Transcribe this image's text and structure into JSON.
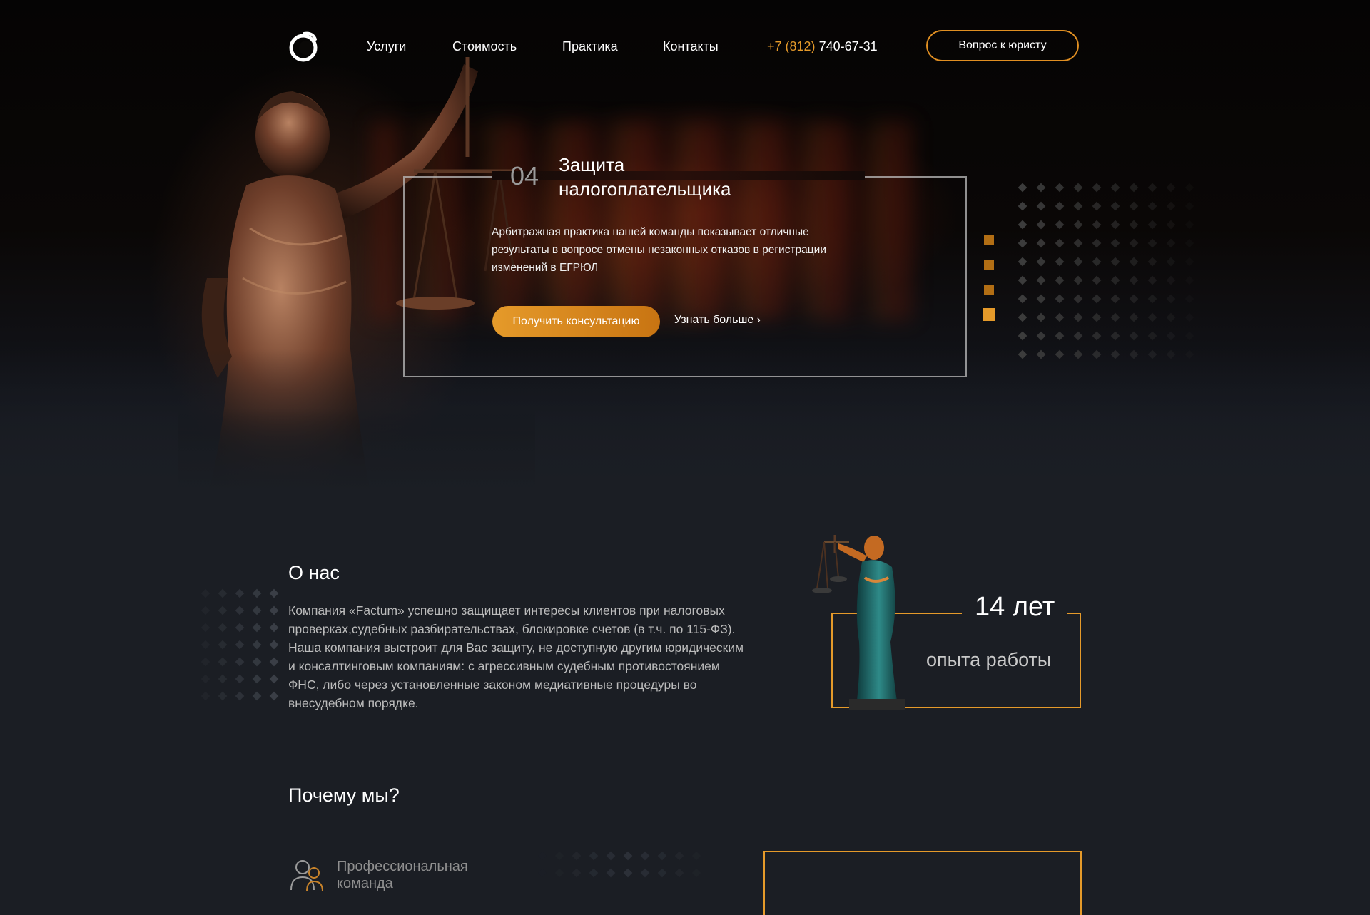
{
  "header": {
    "nav": [
      "Услуги",
      "Стоимость",
      "Практика",
      "Контакты"
    ],
    "phone_code": "+7 (812)",
    "phone_number": "740-67-31",
    "question_button": "Вопрос к юристу"
  },
  "hero": {
    "slide_number": "04",
    "title": "Защита налогоплательщика",
    "text": "Арбитражная практика нашей команды показывает отличные результаты в вопросе отмены незаконных отказов в регистрации изменений в ЕГРЮЛ",
    "consult_button": "Получить консультацию",
    "more_link": "Узнать больше ›",
    "slider": {
      "total": 4,
      "active": 4
    }
  },
  "about": {
    "title": "О нас",
    "text": "Компания «Factum» успешно защищает интересы клиентов при налоговых проверках,судебных разбирательствах, блокировке счетов (в т.ч. по 115-ФЗ). Наша компания выстроит для Вас защиту, не доступную другим юридическим и консалтинговым компаниям: с агрессивным судебным противостоянием ФНС, либо через установленные законом медиативные процедуры во внесудебном порядке.",
    "experience_years": "14 лет",
    "experience_label": "опыта работы"
  },
  "why": {
    "title": "Почему мы?",
    "features": [
      {
        "icon": "team-icon",
        "label": "Профессиональная команда"
      }
    ]
  },
  "colors": {
    "accent": "#e59a2a",
    "background": "#1b1e24",
    "hero_dark": "#050404"
  }
}
